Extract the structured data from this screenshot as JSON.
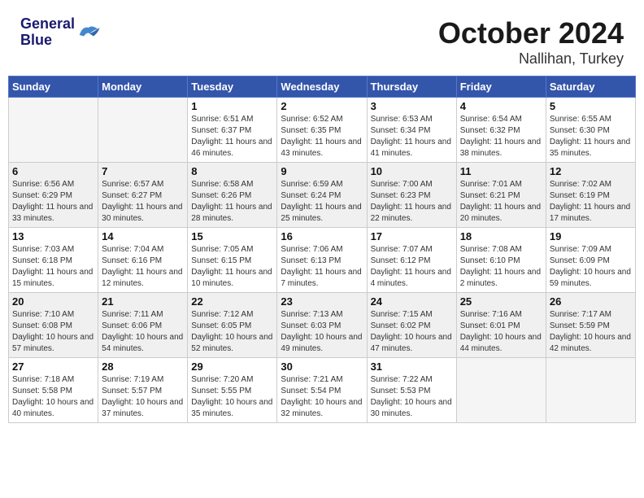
{
  "header": {
    "logo_line1": "General",
    "logo_line2": "Blue",
    "month": "October 2024",
    "location": "Nallihan, Turkey"
  },
  "days_of_week": [
    "Sunday",
    "Monday",
    "Tuesday",
    "Wednesday",
    "Thursday",
    "Friday",
    "Saturday"
  ],
  "weeks": [
    [
      {
        "day": "",
        "info": ""
      },
      {
        "day": "",
        "info": ""
      },
      {
        "day": "1",
        "info": "Sunrise: 6:51 AM\nSunset: 6:37 PM\nDaylight: 11 hours and 46 minutes."
      },
      {
        "day": "2",
        "info": "Sunrise: 6:52 AM\nSunset: 6:35 PM\nDaylight: 11 hours and 43 minutes."
      },
      {
        "day": "3",
        "info": "Sunrise: 6:53 AM\nSunset: 6:34 PM\nDaylight: 11 hours and 41 minutes."
      },
      {
        "day": "4",
        "info": "Sunrise: 6:54 AM\nSunset: 6:32 PM\nDaylight: 11 hours and 38 minutes."
      },
      {
        "day": "5",
        "info": "Sunrise: 6:55 AM\nSunset: 6:30 PM\nDaylight: 11 hours and 35 minutes."
      }
    ],
    [
      {
        "day": "6",
        "info": "Sunrise: 6:56 AM\nSunset: 6:29 PM\nDaylight: 11 hours and 33 minutes."
      },
      {
        "day": "7",
        "info": "Sunrise: 6:57 AM\nSunset: 6:27 PM\nDaylight: 11 hours and 30 minutes."
      },
      {
        "day": "8",
        "info": "Sunrise: 6:58 AM\nSunset: 6:26 PM\nDaylight: 11 hours and 28 minutes."
      },
      {
        "day": "9",
        "info": "Sunrise: 6:59 AM\nSunset: 6:24 PM\nDaylight: 11 hours and 25 minutes."
      },
      {
        "day": "10",
        "info": "Sunrise: 7:00 AM\nSunset: 6:23 PM\nDaylight: 11 hours and 22 minutes."
      },
      {
        "day": "11",
        "info": "Sunrise: 7:01 AM\nSunset: 6:21 PM\nDaylight: 11 hours and 20 minutes."
      },
      {
        "day": "12",
        "info": "Sunrise: 7:02 AM\nSunset: 6:19 PM\nDaylight: 11 hours and 17 minutes."
      }
    ],
    [
      {
        "day": "13",
        "info": "Sunrise: 7:03 AM\nSunset: 6:18 PM\nDaylight: 11 hours and 15 minutes."
      },
      {
        "day": "14",
        "info": "Sunrise: 7:04 AM\nSunset: 6:16 PM\nDaylight: 11 hours and 12 minutes."
      },
      {
        "day": "15",
        "info": "Sunrise: 7:05 AM\nSunset: 6:15 PM\nDaylight: 11 hours and 10 minutes."
      },
      {
        "day": "16",
        "info": "Sunrise: 7:06 AM\nSunset: 6:13 PM\nDaylight: 11 hours and 7 minutes."
      },
      {
        "day": "17",
        "info": "Sunrise: 7:07 AM\nSunset: 6:12 PM\nDaylight: 11 hours and 4 minutes."
      },
      {
        "day": "18",
        "info": "Sunrise: 7:08 AM\nSunset: 6:10 PM\nDaylight: 11 hours and 2 minutes."
      },
      {
        "day": "19",
        "info": "Sunrise: 7:09 AM\nSunset: 6:09 PM\nDaylight: 10 hours and 59 minutes."
      }
    ],
    [
      {
        "day": "20",
        "info": "Sunrise: 7:10 AM\nSunset: 6:08 PM\nDaylight: 10 hours and 57 minutes."
      },
      {
        "day": "21",
        "info": "Sunrise: 7:11 AM\nSunset: 6:06 PM\nDaylight: 10 hours and 54 minutes."
      },
      {
        "day": "22",
        "info": "Sunrise: 7:12 AM\nSunset: 6:05 PM\nDaylight: 10 hours and 52 minutes."
      },
      {
        "day": "23",
        "info": "Sunrise: 7:13 AM\nSunset: 6:03 PM\nDaylight: 10 hours and 49 minutes."
      },
      {
        "day": "24",
        "info": "Sunrise: 7:15 AM\nSunset: 6:02 PM\nDaylight: 10 hours and 47 minutes."
      },
      {
        "day": "25",
        "info": "Sunrise: 7:16 AM\nSunset: 6:01 PM\nDaylight: 10 hours and 44 minutes."
      },
      {
        "day": "26",
        "info": "Sunrise: 7:17 AM\nSunset: 5:59 PM\nDaylight: 10 hours and 42 minutes."
      }
    ],
    [
      {
        "day": "27",
        "info": "Sunrise: 7:18 AM\nSunset: 5:58 PM\nDaylight: 10 hours and 40 minutes."
      },
      {
        "day": "28",
        "info": "Sunrise: 7:19 AM\nSunset: 5:57 PM\nDaylight: 10 hours and 37 minutes."
      },
      {
        "day": "29",
        "info": "Sunrise: 7:20 AM\nSunset: 5:55 PM\nDaylight: 10 hours and 35 minutes."
      },
      {
        "day": "30",
        "info": "Sunrise: 7:21 AM\nSunset: 5:54 PM\nDaylight: 10 hours and 32 minutes."
      },
      {
        "day": "31",
        "info": "Sunrise: 7:22 AM\nSunset: 5:53 PM\nDaylight: 10 hours and 30 minutes."
      },
      {
        "day": "",
        "info": ""
      },
      {
        "day": "",
        "info": ""
      }
    ]
  ]
}
